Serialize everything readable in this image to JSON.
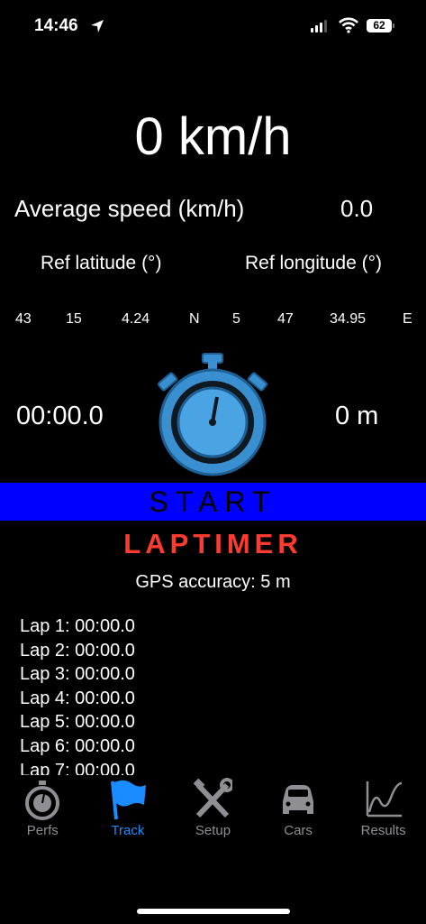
{
  "status": {
    "time": "14:46",
    "battery": "62"
  },
  "speed": "0 km/h",
  "average": {
    "label": "Average speed (km/h)",
    "value": "0.0"
  },
  "ref": {
    "lat_label": "Ref latitude (°)",
    "lon_label": "Ref longitude (°)"
  },
  "coords": {
    "lat_deg": "43",
    "lat_min": "15",
    "lat_sec": "4.24",
    "lat_hem": "N",
    "lon_deg": "5",
    "lon_min": "47",
    "lon_sec": "34.95",
    "lon_hem": "E"
  },
  "timer": "00:00.0",
  "distance": "0 m",
  "start_label": "START",
  "laptimer_label": "LAPTIMER",
  "gps_accuracy": "GPS accuracy: 5 m",
  "laps": [
    "Lap 1: 00:00.0",
    "Lap 2: 00:00.0",
    "Lap 3: 00:00.0",
    "Lap 4: 00:00.0",
    "Lap 5: 00:00.0",
    "Lap 6: 00:00.0",
    "Lap 7: 00:00.0"
  ],
  "tabs": [
    {
      "label": "Perfs",
      "icon": "stopwatch-icon",
      "active": false
    },
    {
      "label": "Track",
      "icon": "flag-icon",
      "active": true
    },
    {
      "label": "Setup",
      "icon": "tools-icon",
      "active": false
    },
    {
      "label": "Cars",
      "icon": "car-icon",
      "active": false
    },
    {
      "label": "Results",
      "icon": "chart-icon",
      "active": false
    }
  ],
  "colors": {
    "accent": "#1a8cff",
    "start_bar": "#0000ff",
    "laptimer": "#ff3b30",
    "stopwatch": "#3a8fd0"
  }
}
